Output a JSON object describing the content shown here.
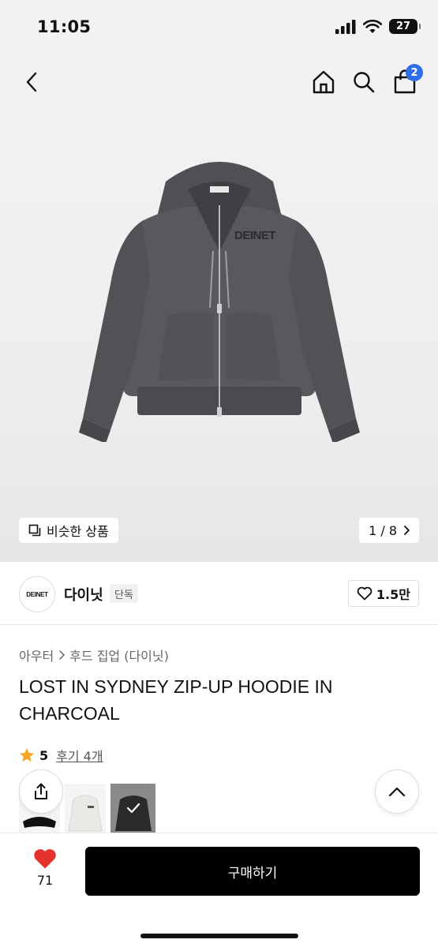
{
  "status_bar": {
    "time": "11:05",
    "battery": "27"
  },
  "nav": {
    "cart_count": "2"
  },
  "gallery": {
    "similar_label": "비슷한 상품",
    "pager": "1 / 8",
    "print_text": "DEINET"
  },
  "seller": {
    "logo_text": "DEINET",
    "name": "다이닛",
    "badge": "단독",
    "likes": "1.5만"
  },
  "breadcrumb": {
    "level1": "아우터",
    "level2": "후드 집업 (다이닛)"
  },
  "product": {
    "title": "LOST IN SYDNEY ZIP-UP HOODIE IN CHARCOAL",
    "rating": "5",
    "review_label": "후기 4개"
  },
  "bottom": {
    "wish_count": "71",
    "buy_label": "구매하기"
  },
  "colors": {
    "accent_blue": "#2f6ee6",
    "heart_red": "#e5322d",
    "star_gold": "#f5a623",
    "hoodie": "#55565a"
  }
}
